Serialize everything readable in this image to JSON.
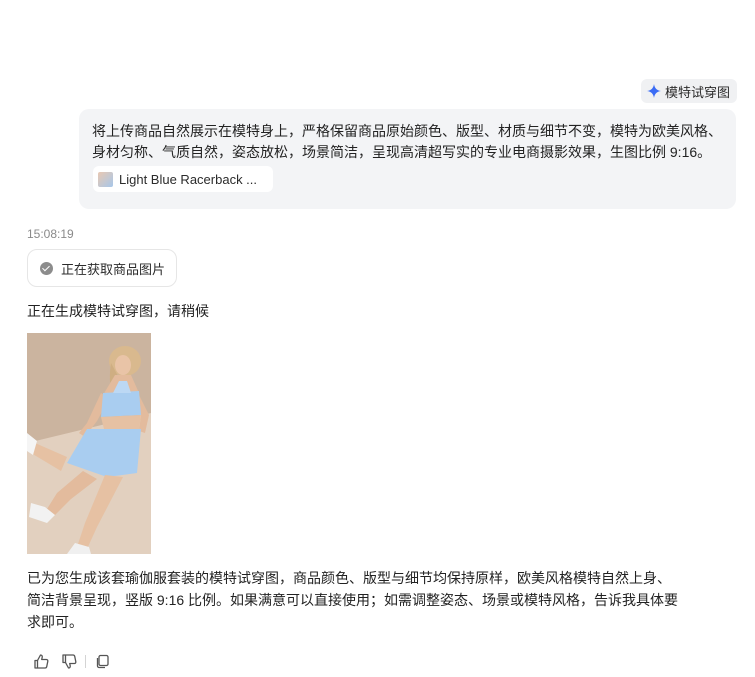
{
  "tag": {
    "label": "模特试穿图",
    "icon": "sparkle-icon",
    "accent": "#3b6cf5"
  },
  "user_message": {
    "text": "将上传商品自然展示在模特身上，严格保留商品原始颜色、版型、材质与细节不变，模特为欧美风格、身材匀称、气质自然，姿态放松，场景简洁，呈现高清超写实的专业电商摄影效果，生图比例 9:16。",
    "attachment": "Light Blue Racerback ..."
  },
  "timestamp": "15:08:19",
  "status": {
    "label": "正在获取商品图片",
    "icon": "check-circle-icon"
  },
  "generating_text": "正在生成模特试穿图，请稍候",
  "summary": {
    "line1": "已为您生成该套瑜伽服套装的模特试穿图，商品颜色、版型与细节均保持原样，欧美风格模特自然上身、",
    "line2": "简洁背景呈现，竖版 9:16 比例。如果满意可以直接使用；如需调整姿态、场景或模特风格，告诉我具体要",
    "line3": "求即可。"
  },
  "actions": [
    "thumbs-up-icon",
    "thumbs-down-icon",
    "copy-icon"
  ]
}
